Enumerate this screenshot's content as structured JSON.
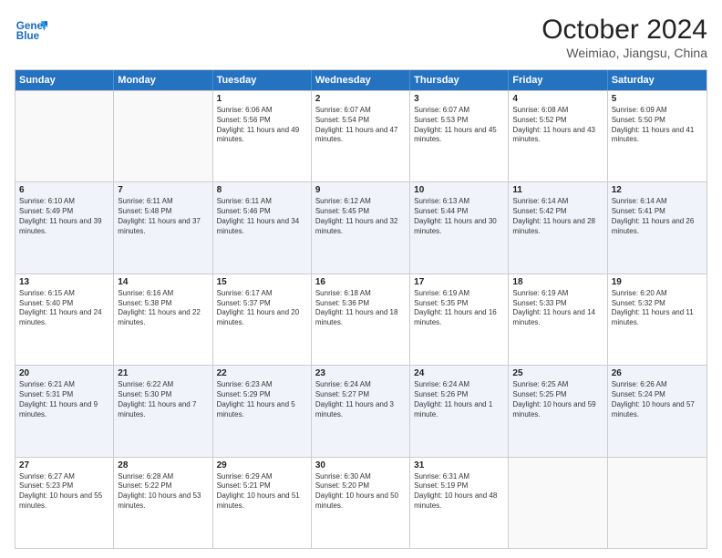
{
  "header": {
    "logo_line1": "General",
    "logo_line2": "Blue",
    "title": "October 2024",
    "subtitle": "Weimiao, Jiangsu, China"
  },
  "days_of_week": [
    "Sunday",
    "Monday",
    "Tuesday",
    "Wednesday",
    "Thursday",
    "Friday",
    "Saturday"
  ],
  "weeks": [
    [
      {
        "day": "",
        "info": ""
      },
      {
        "day": "",
        "info": ""
      },
      {
        "day": "1",
        "info": "Sunrise: 6:06 AM\nSunset: 5:56 PM\nDaylight: 11 hours and 49 minutes."
      },
      {
        "day": "2",
        "info": "Sunrise: 6:07 AM\nSunset: 5:54 PM\nDaylight: 11 hours and 47 minutes."
      },
      {
        "day": "3",
        "info": "Sunrise: 6:07 AM\nSunset: 5:53 PM\nDaylight: 11 hours and 45 minutes."
      },
      {
        "day": "4",
        "info": "Sunrise: 6:08 AM\nSunset: 5:52 PM\nDaylight: 11 hours and 43 minutes."
      },
      {
        "day": "5",
        "info": "Sunrise: 6:09 AM\nSunset: 5:50 PM\nDaylight: 11 hours and 41 minutes."
      }
    ],
    [
      {
        "day": "6",
        "info": "Sunrise: 6:10 AM\nSunset: 5:49 PM\nDaylight: 11 hours and 39 minutes."
      },
      {
        "day": "7",
        "info": "Sunrise: 6:11 AM\nSunset: 5:48 PM\nDaylight: 11 hours and 37 minutes."
      },
      {
        "day": "8",
        "info": "Sunrise: 6:11 AM\nSunset: 5:46 PM\nDaylight: 11 hours and 34 minutes."
      },
      {
        "day": "9",
        "info": "Sunrise: 6:12 AM\nSunset: 5:45 PM\nDaylight: 11 hours and 32 minutes."
      },
      {
        "day": "10",
        "info": "Sunrise: 6:13 AM\nSunset: 5:44 PM\nDaylight: 11 hours and 30 minutes."
      },
      {
        "day": "11",
        "info": "Sunrise: 6:14 AM\nSunset: 5:42 PM\nDaylight: 11 hours and 28 minutes."
      },
      {
        "day": "12",
        "info": "Sunrise: 6:14 AM\nSunset: 5:41 PM\nDaylight: 11 hours and 26 minutes."
      }
    ],
    [
      {
        "day": "13",
        "info": "Sunrise: 6:15 AM\nSunset: 5:40 PM\nDaylight: 11 hours and 24 minutes."
      },
      {
        "day": "14",
        "info": "Sunrise: 6:16 AM\nSunset: 5:38 PM\nDaylight: 11 hours and 22 minutes."
      },
      {
        "day": "15",
        "info": "Sunrise: 6:17 AM\nSunset: 5:37 PM\nDaylight: 11 hours and 20 minutes."
      },
      {
        "day": "16",
        "info": "Sunrise: 6:18 AM\nSunset: 5:36 PM\nDaylight: 11 hours and 18 minutes."
      },
      {
        "day": "17",
        "info": "Sunrise: 6:19 AM\nSunset: 5:35 PM\nDaylight: 11 hours and 16 minutes."
      },
      {
        "day": "18",
        "info": "Sunrise: 6:19 AM\nSunset: 5:33 PM\nDaylight: 11 hours and 14 minutes."
      },
      {
        "day": "19",
        "info": "Sunrise: 6:20 AM\nSunset: 5:32 PM\nDaylight: 11 hours and 11 minutes."
      }
    ],
    [
      {
        "day": "20",
        "info": "Sunrise: 6:21 AM\nSunset: 5:31 PM\nDaylight: 11 hours and 9 minutes."
      },
      {
        "day": "21",
        "info": "Sunrise: 6:22 AM\nSunset: 5:30 PM\nDaylight: 11 hours and 7 minutes."
      },
      {
        "day": "22",
        "info": "Sunrise: 6:23 AM\nSunset: 5:29 PM\nDaylight: 11 hours and 5 minutes."
      },
      {
        "day": "23",
        "info": "Sunrise: 6:24 AM\nSunset: 5:27 PM\nDaylight: 11 hours and 3 minutes."
      },
      {
        "day": "24",
        "info": "Sunrise: 6:24 AM\nSunset: 5:26 PM\nDaylight: 11 hours and 1 minute."
      },
      {
        "day": "25",
        "info": "Sunrise: 6:25 AM\nSunset: 5:25 PM\nDaylight: 10 hours and 59 minutes."
      },
      {
        "day": "26",
        "info": "Sunrise: 6:26 AM\nSunset: 5:24 PM\nDaylight: 10 hours and 57 minutes."
      }
    ],
    [
      {
        "day": "27",
        "info": "Sunrise: 6:27 AM\nSunset: 5:23 PM\nDaylight: 10 hours and 55 minutes."
      },
      {
        "day": "28",
        "info": "Sunrise: 6:28 AM\nSunset: 5:22 PM\nDaylight: 10 hours and 53 minutes."
      },
      {
        "day": "29",
        "info": "Sunrise: 6:29 AM\nSunset: 5:21 PM\nDaylight: 10 hours and 51 minutes."
      },
      {
        "day": "30",
        "info": "Sunrise: 6:30 AM\nSunset: 5:20 PM\nDaylight: 10 hours and 50 minutes."
      },
      {
        "day": "31",
        "info": "Sunrise: 6:31 AM\nSunset: 5:19 PM\nDaylight: 10 hours and 48 minutes."
      },
      {
        "day": "",
        "info": ""
      },
      {
        "day": "",
        "info": ""
      }
    ]
  ]
}
